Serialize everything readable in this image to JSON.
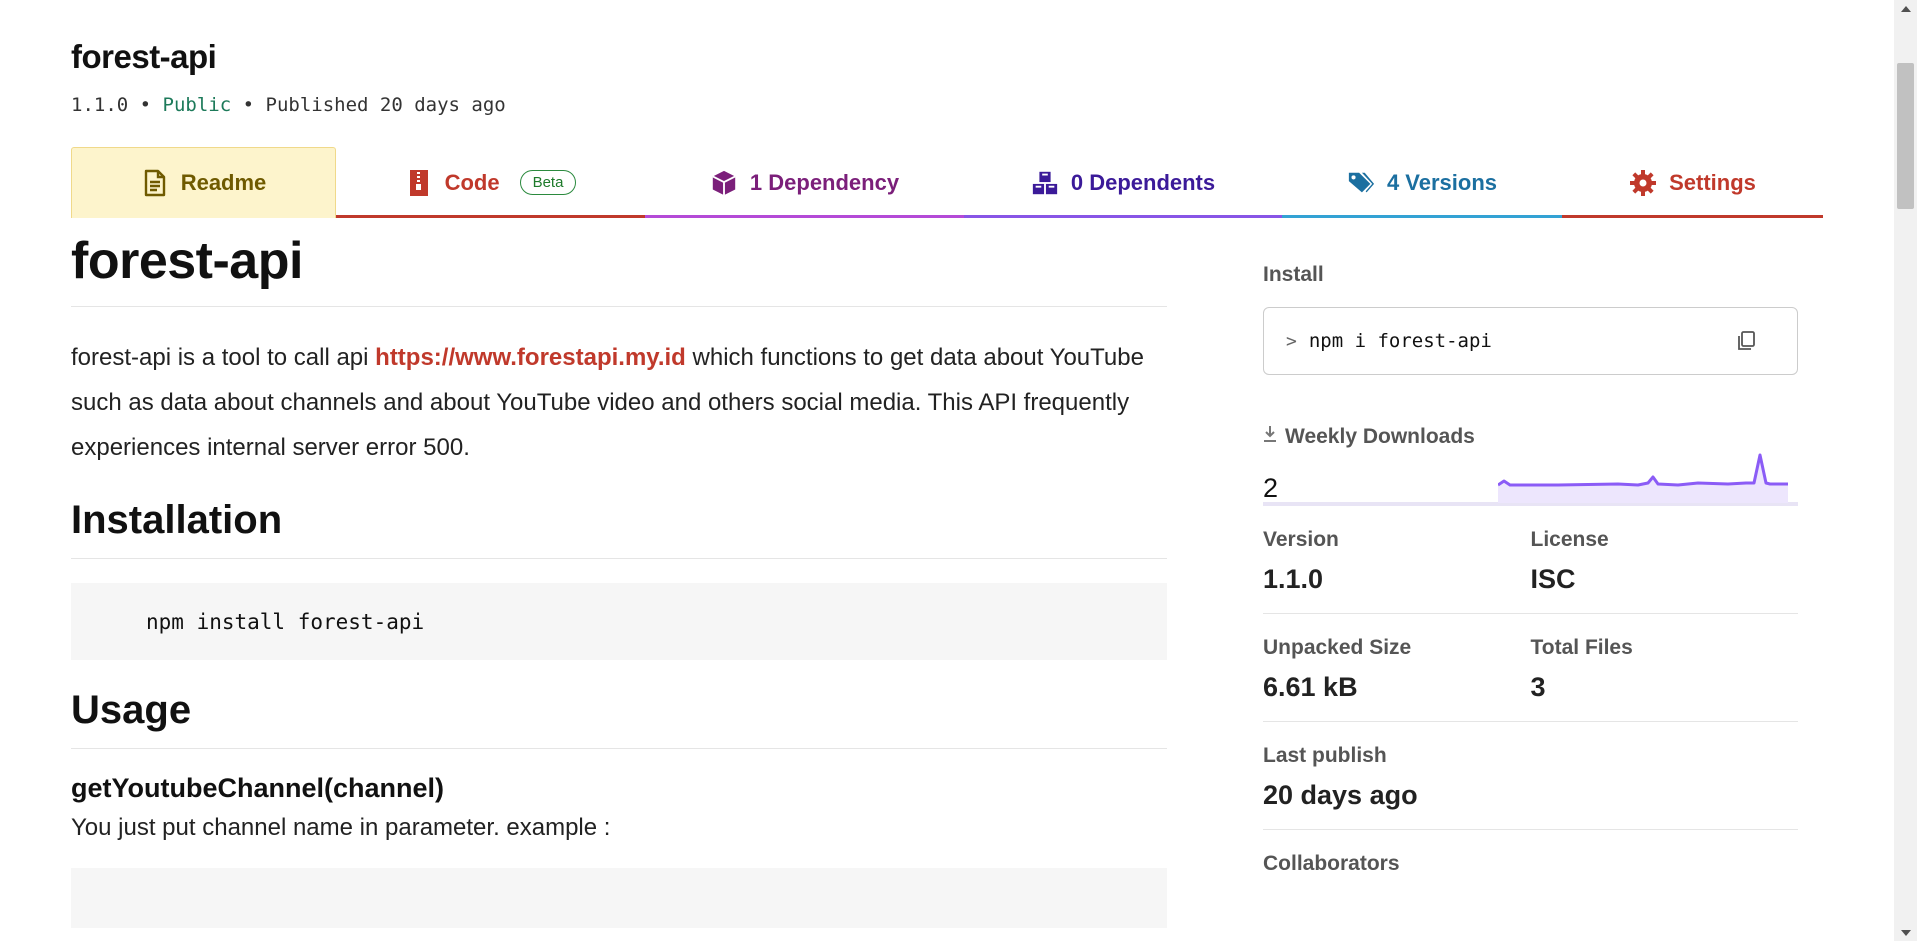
{
  "package": {
    "name": "forest-api",
    "version": "1.1.0",
    "sep1": " • ",
    "visibility": "Public",
    "sep2": " • ",
    "published": "Published 20 days ago"
  },
  "tabs": {
    "readme": "Readme",
    "code": "Code",
    "code_badge": "Beta",
    "dependency": "1 Dependency",
    "dependents": "0 Dependents",
    "versions": "4 Versions",
    "settings": "Settings"
  },
  "readme": {
    "title": "forest-api",
    "intro_before": "forest-api is a tool to call api ",
    "intro_link": "https://www.forestapi.my.id",
    "intro_after": " which functions to get data about YouTube such as data about channels and about YouTube video and others social media. This API frequently experiences internal server error 500.",
    "installation_heading": "Installation",
    "install_code": "npm install forest-api",
    "usage_heading": "Usage",
    "method_heading": "getYoutubeChannel(channel)",
    "method_desc": "You just put channel name in parameter. example :"
  },
  "sidebar": {
    "install_label": "Install",
    "install_prompt": ">",
    "install_cmd": "npm i forest-api",
    "weekly_downloads_label": "Weekly Downloads",
    "weekly_downloads": "2",
    "version_label": "Version",
    "version": "1.1.0",
    "license_label": "License",
    "license": "ISC",
    "unpacked_size_label": "Unpacked Size",
    "unpacked_size": "6.61 kB",
    "total_files_label": "Total Files",
    "total_files": "3",
    "last_publish_label": "Last publish",
    "last_publish": "20 days ago",
    "collaborators_label": "Collaborators"
  },
  "colors": {
    "readme_tab_bg": "#fdf4cc",
    "link": "#c0392b",
    "sparkline": "#8b5cf6"
  },
  "icons": {
    "readme": "file-text-icon",
    "code": "file-zip-icon",
    "dependency": "box-icon",
    "dependents": "boxes-icon",
    "versions": "tags-icon",
    "settings": "gear-icon",
    "copy": "copy-icon",
    "download": "download-icon"
  }
}
